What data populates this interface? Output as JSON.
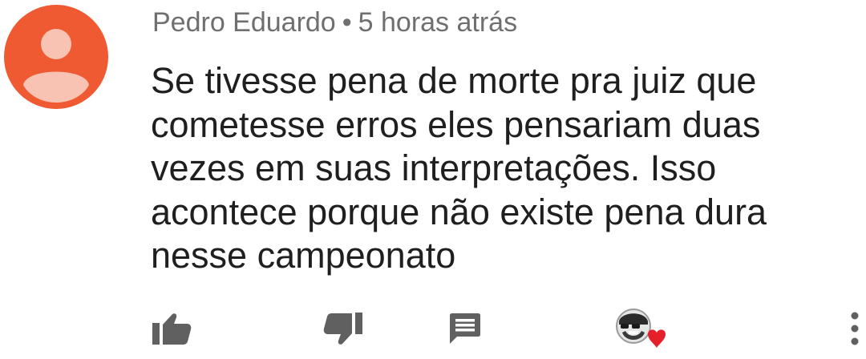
{
  "comment": {
    "author": "Pedro Eduardo",
    "separator": "•",
    "time": "5 horas atrás",
    "lines": [
      "Se tivesse pena de morte pra juiz que",
      "cometesse erros eles pensariam duas",
      "vezes em suas interpretações. Isso",
      "acontece porque não existe pena dura",
      "nesse campeonato"
    ],
    "avatar_color": "#f05a33",
    "avatar_person_color": "#f9c3b3"
  },
  "actions": {
    "icons": [
      "thumbs-up-icon",
      "thumbs-down-icon",
      "reply-icon",
      "creator-heart-icon",
      "more-vert-icon"
    ],
    "icon_color": "#606060",
    "heart_color": "#e5202a"
  }
}
